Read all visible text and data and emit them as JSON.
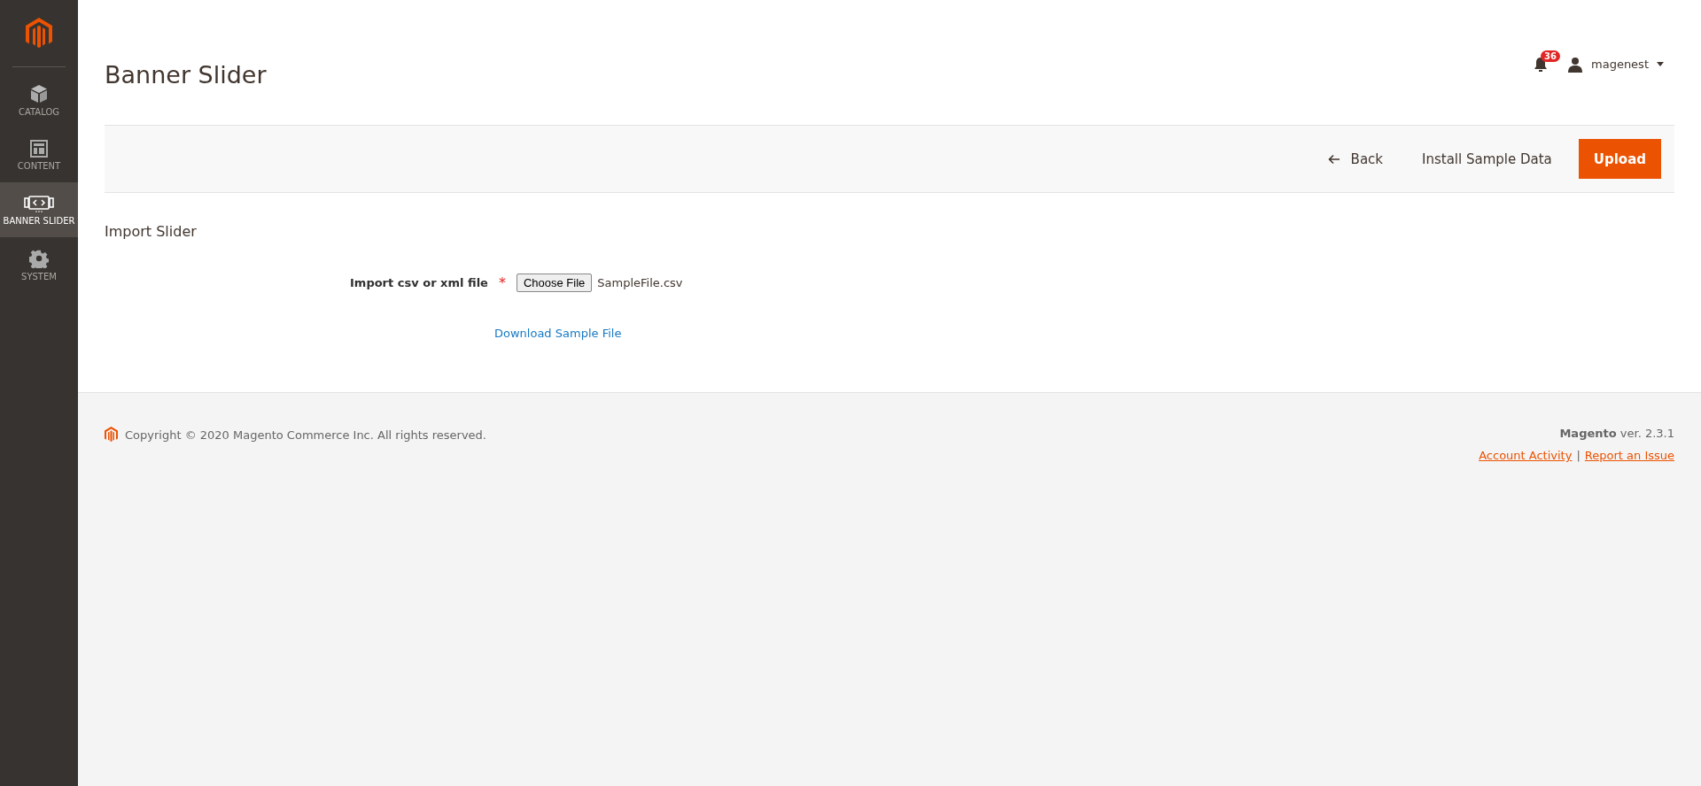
{
  "sidebar": {
    "items": [
      {
        "kind": "box",
        "label": "CATALOG",
        "selected": false
      },
      {
        "kind": "layout",
        "label": "CONTENT",
        "selected": false
      },
      {
        "kind": "slider",
        "label": "BANNER SLIDER",
        "selected": true
      },
      {
        "kind": "gear",
        "label": "SYSTEM",
        "selected": false
      }
    ]
  },
  "header": {
    "title": "Banner Slider",
    "notifications": "36",
    "user": "magenest"
  },
  "actions": [
    {
      "kind": "back",
      "label": "Back"
    },
    {
      "kind": "plain",
      "label": "Install Sample Data"
    },
    {
      "kind": "primary",
      "label": "Upload"
    }
  ],
  "section": {
    "title": "Import Slider",
    "field_label": "Import csv or xml file",
    "required_mark": "*",
    "file_button": "Choose File",
    "file_name": "SampleFile.csv",
    "download_link": "Download Sample File"
  },
  "footer": {
    "copyright": "Copyright © 2020 Magento Commerce Inc. All rights reserved.",
    "version": "**Magento** ver. 2.3.1",
    "links": [
      "Account Activity",
      "Report an Issue"
    ],
    "separator": "|"
  }
}
